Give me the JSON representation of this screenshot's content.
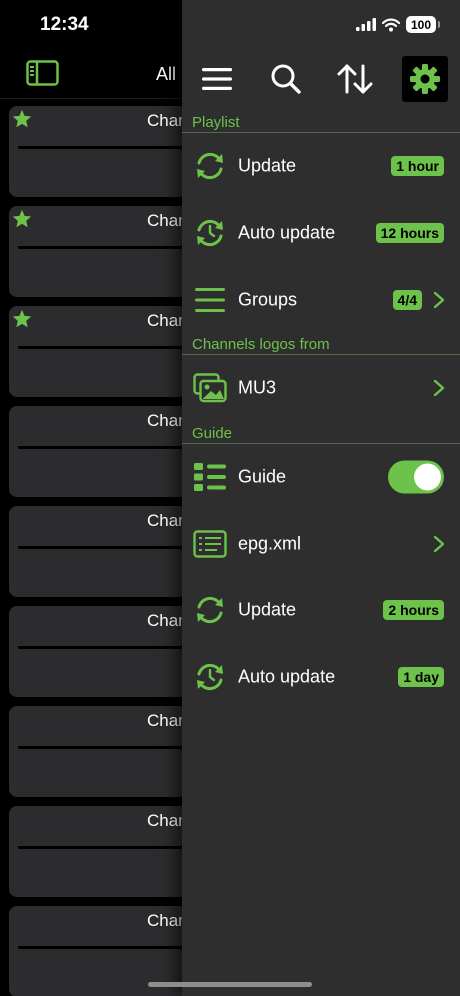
{
  "status_bar": {
    "time": "12:34",
    "battery": "100"
  },
  "background": {
    "filter_label": "All",
    "channels": [
      {
        "name": "Channel",
        "favorite": true
      },
      {
        "name": "Channel",
        "favorite": true
      },
      {
        "name": "Channel",
        "favorite": true
      },
      {
        "name": "Channel",
        "favorite": false
      },
      {
        "name": "Channel",
        "favorite": false
      },
      {
        "name": "Channel",
        "favorite": false
      },
      {
        "name": "Channel",
        "favorite": false
      },
      {
        "name": "Channel",
        "favorite": false
      },
      {
        "name": "Channel",
        "favorite": false
      }
    ]
  },
  "toolbar": {
    "icons": [
      "menu-icon",
      "search-icon",
      "sort-icon",
      "gear-icon"
    ],
    "active": "gear-icon"
  },
  "playlist": {
    "header": "Playlist",
    "update_label": "Update",
    "update_value": "1 hour",
    "auto_update_label": "Auto update",
    "auto_update_value": "12 hours",
    "groups_label": "Groups",
    "groups_value": "4/4"
  },
  "logos": {
    "header": "Channels logos from",
    "source_label": "MU3"
  },
  "guide": {
    "header": "Guide",
    "guide_label": "Guide",
    "guide_enabled": true,
    "epg_label": "epg.xml",
    "update_label": "Update",
    "update_value": "2 hours",
    "auto_update_label": "Auto update",
    "auto_update_value": "1 day"
  },
  "colors": {
    "accent": "#6cc24a",
    "panel_bg": "#2e2e2e",
    "card_bg": "#2c2c2e",
    "background": "#000000"
  }
}
